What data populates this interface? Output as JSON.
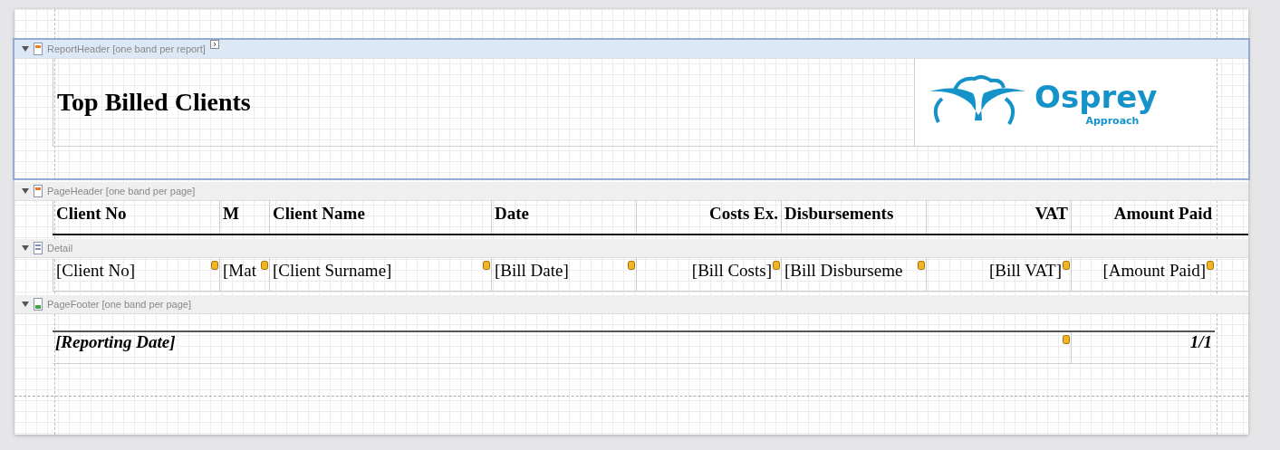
{
  "report_header": {
    "label": "ReportHeader [one band per report]",
    "kind": "header",
    "selected": true,
    "title": "Top Billed Clients",
    "logo": {
      "name": "Osprey",
      "tagline": "Approach"
    }
  },
  "page_header": {
    "label": "PageHeader [one band per page]",
    "kind": "header",
    "selected": false,
    "columns": [
      {
        "text": "Client No",
        "right_aligned": false
      },
      {
        "text": "M",
        "right_aligned": false
      },
      {
        "text": "Client Name",
        "right_aligned": false
      },
      {
        "text": "Date",
        "right_aligned": false
      },
      {
        "text": "Costs Ex.",
        "right_aligned": true
      },
      {
        "text": "Disbursements",
        "right_aligned": false
      },
      {
        "text": "VAT",
        "right_aligned": true
      },
      {
        "text": "Amount Paid",
        "right_aligned": true
      }
    ]
  },
  "detail": {
    "label": "Detail",
    "kind": "detail",
    "selected": false,
    "cells": [
      {
        "text": "[Client No]",
        "right_aligned": false
      },
      {
        "text": "[Mat",
        "right_aligned": false
      },
      {
        "text": "[Client Surname]",
        "right_aligned": false
      },
      {
        "text": "[Bill Date]",
        "right_aligned": false
      },
      {
        "text": "[Bill Costs]",
        "right_aligned": true
      },
      {
        "text": "[Bill Disburseme",
        "right_aligned": false
      },
      {
        "text": "[Bill VAT]",
        "right_aligned": true
      },
      {
        "text": "[Amount Paid]",
        "right_aligned": true
      }
    ]
  },
  "page_footer": {
    "label": "PageFooter [one band per page]",
    "kind": "footer",
    "selected": false,
    "reporting_date": "[Reporting Date]",
    "page_number": "1/1"
  }
}
